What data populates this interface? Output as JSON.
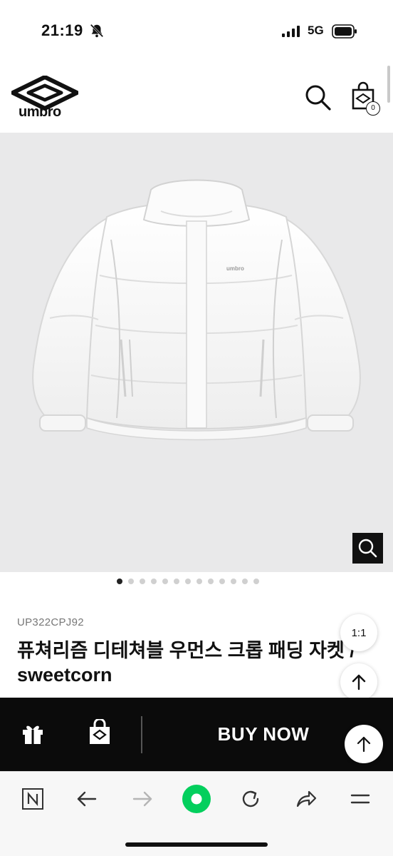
{
  "status_bar": {
    "time": "21:19",
    "network": "5G"
  },
  "header": {
    "brand": "umbro",
    "cart_count": "0"
  },
  "product": {
    "sku": "UP322CPJ92",
    "title": "퓨쳐리즘 디테쳐블 우먼스 크롭 패딩 자켓 / sweetcorn",
    "image_logo": "umbro",
    "image_count": 13,
    "active_image": 0
  },
  "floating": {
    "ratio_label": "1:1"
  },
  "purchase_bar": {
    "buy_now_label": "BUY NOW"
  },
  "browser_toolbar": {
    "items": [
      "naver-home",
      "back",
      "forward",
      "record",
      "refresh",
      "share",
      "menu"
    ],
    "accent_color": "#03cf5d"
  },
  "colors": {
    "image_bg": "#e9e9ea",
    "bar_bg": "#0b0b0b"
  }
}
